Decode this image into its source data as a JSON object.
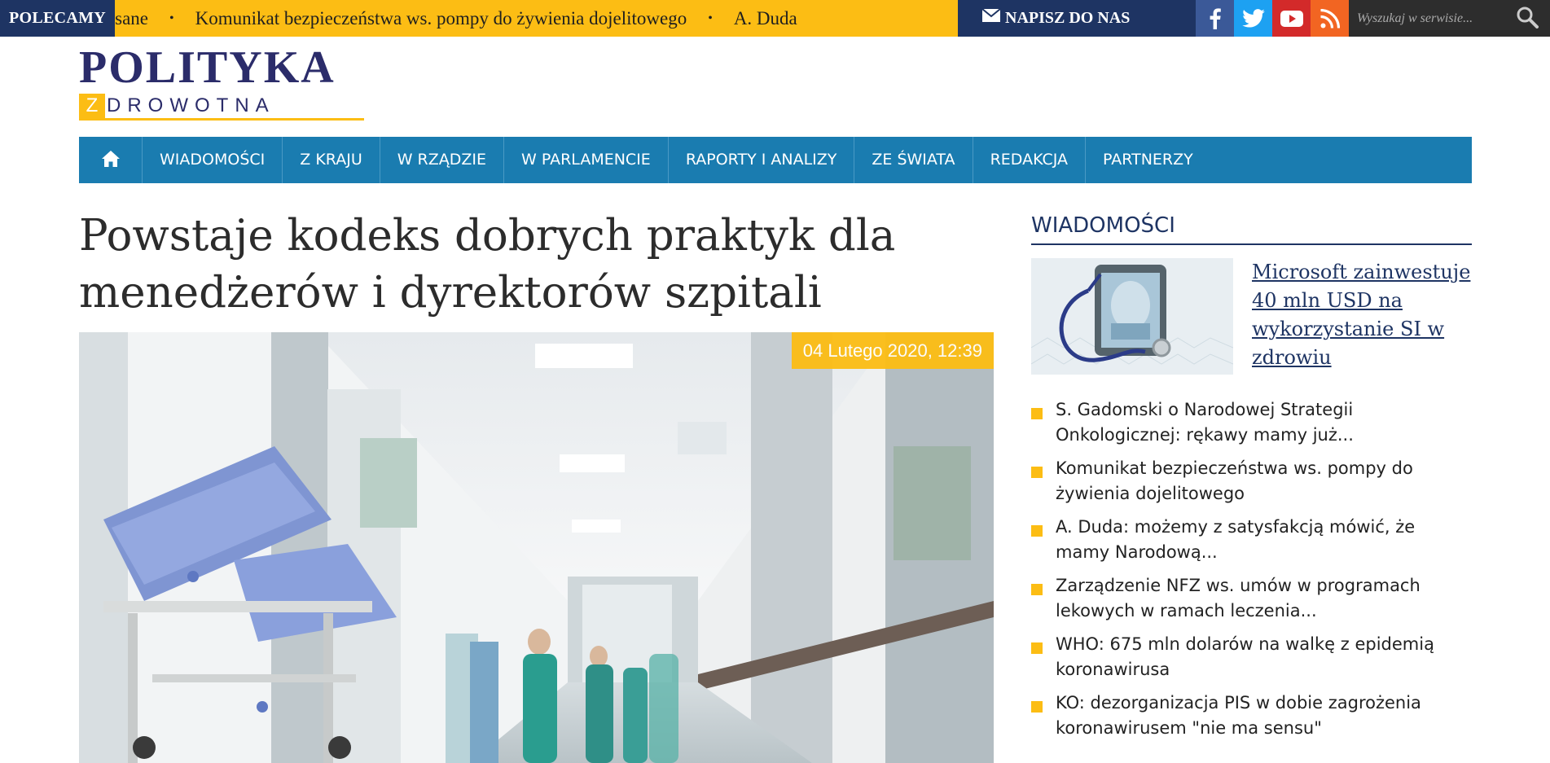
{
  "topbar": {
    "polecamy_label": "POLECAMY",
    "ticker": [
      "zakasane",
      "Komunikat bezpieczeństwa ws. pompy do żywienia dojelitowego",
      "A. Duda"
    ],
    "ticker_separator": "•",
    "contact_label": "NAPISZ DO NAS",
    "social": [
      "facebook-icon",
      "twitter-icon",
      "youtube-icon",
      "rss-icon"
    ],
    "search_placeholder": "Wyszukaj w serwisie..."
  },
  "logo": {
    "top": "POLITYKA",
    "z": "Z",
    "rest": "DROWOTNA"
  },
  "nav": {
    "items": [
      "WIADOMOŚCI",
      "Z KRAJU",
      "W RZĄDZIE",
      "W PARLAMENCIE",
      "RAPORTY I ANALIZY",
      "ZE ŚWIATA",
      "REDAKCJA",
      "PARTNERZY"
    ]
  },
  "article": {
    "title": "Powstaje kodeks dobrych praktyk dla menedżerów i dyrektorów szpitali",
    "date": "04 Lutego 2020, 12:39"
  },
  "sidebar": {
    "title": "WIADOMOŚCI",
    "featured": {
      "title": "Microsoft zainwestuje 40 mln USD na wykorzystanie SI w zdrowiu"
    },
    "news": [
      "S. Gadomski o Narodowej Strategii Onkologicznej: rękawy mamy już...",
      "Komunikat bezpieczeństwa ws. pompy do żywienia dojelitowego",
      "A. Duda: możemy z satysfakcją mówić, że mamy Narodową...",
      "Zarządzenie NFZ ws. umów w programach lekowych w ramach leczenia...",
      "WHO: 675 mln dolarów na walkę z epidemią koronawirusa",
      "KO: dezorganizacja PIS w dobie zagrożenia koronawirusem \"nie ma sensu\""
    ]
  },
  "colors": {
    "navy": "#1e3463",
    "yellow": "#fcbd14",
    "nav_blue": "#1a7cb0"
  }
}
